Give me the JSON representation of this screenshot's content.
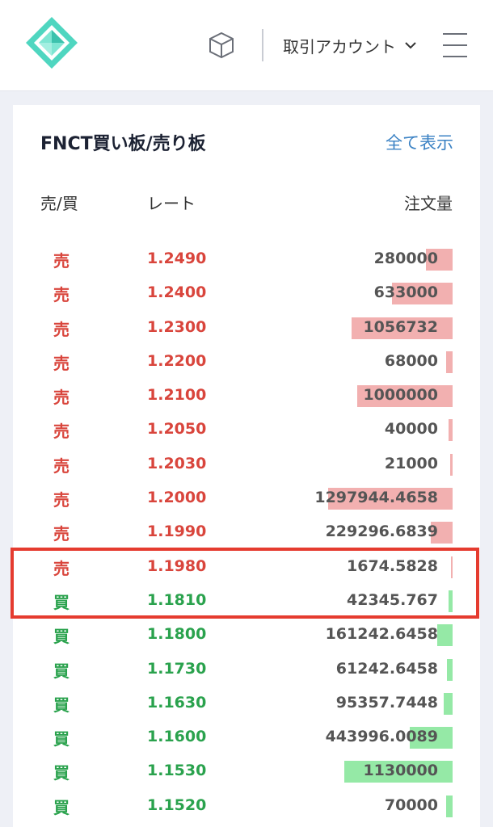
{
  "header": {
    "account_label": "取引アカウント"
  },
  "orderbook": {
    "title": "FNCT買い板/売り板",
    "show_all": "全て表示",
    "columns": {
      "side": "売/買",
      "rate": "レート",
      "volume": "注文量"
    },
    "rows": [
      {
        "side": "売",
        "type": "sell",
        "rate": "1.2490",
        "volume": "280000",
        "depth": 0.065
      },
      {
        "side": "売",
        "type": "sell",
        "rate": "1.2400",
        "volume": "633000",
        "depth": 0.147
      },
      {
        "side": "売",
        "type": "sell",
        "rate": "1.2300",
        "volume": "1056732",
        "depth": 0.245
      },
      {
        "side": "売",
        "type": "sell",
        "rate": "1.2200",
        "volume": "68000",
        "depth": 0.016
      },
      {
        "side": "売",
        "type": "sell",
        "rate": "1.2100",
        "volume": "1000000",
        "depth": 0.232
      },
      {
        "side": "売",
        "type": "sell",
        "rate": "1.2050",
        "volume": "40000",
        "depth": 0.009
      },
      {
        "side": "売",
        "type": "sell",
        "rate": "1.2030",
        "volume": "21000",
        "depth": 0.005
      },
      {
        "side": "売",
        "type": "sell",
        "rate": "1.2000",
        "volume": "1297944.4658",
        "depth": 0.301
      },
      {
        "side": "売",
        "type": "sell",
        "rate": "1.1990",
        "volume": "229296.6839",
        "depth": 0.053
      },
      {
        "side": "売",
        "type": "sell",
        "rate": "1.1980",
        "volume": "1674.5828",
        "depth": 0.0004
      },
      {
        "side": "買",
        "type": "buy",
        "rate": "1.1810",
        "volume": "42345.767",
        "depth": 0.01
      },
      {
        "side": "買",
        "type": "buy",
        "rate": "1.1800",
        "volume": "161242.6458",
        "depth": 0.037
      },
      {
        "side": "買",
        "type": "buy",
        "rate": "1.1730",
        "volume": "61242.6458",
        "depth": 0.014
      },
      {
        "side": "買",
        "type": "buy",
        "rate": "1.1630",
        "volume": "95357.7448",
        "depth": 0.022
      },
      {
        "side": "買",
        "type": "buy",
        "rate": "1.1600",
        "volume": "443996.0089",
        "depth": 0.103
      },
      {
        "side": "買",
        "type": "buy",
        "rate": "1.1530",
        "volume": "1130000",
        "depth": 0.262
      },
      {
        "side": "買",
        "type": "buy",
        "rate": "1.1520",
        "volume": "70000",
        "depth": 0.016
      }
    ]
  },
  "icons": {
    "logo": "logo-diamond-icon",
    "cube": "cube-icon",
    "chevron": "chevron-down-icon",
    "menu": "menu-icon"
  },
  "colors": {
    "sell": "#d9453c",
    "buy": "#2aa24d",
    "sell_bar": "#f2b0b0",
    "buy_bar": "#95e9a6",
    "link": "#3b82c4",
    "highlight": "#e53b2f"
  }
}
